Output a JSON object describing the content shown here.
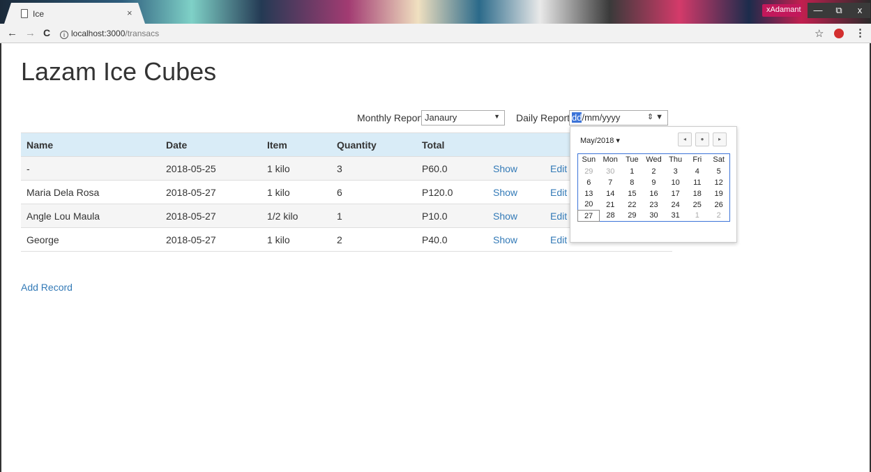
{
  "browser": {
    "tab_title": "Ice",
    "tab_close": "×",
    "user_name": "xAdamant",
    "window_controls": [
      "—",
      "⧉",
      "x"
    ],
    "url_host": "localhost:3000",
    "url_path": "/transacs",
    "info_glyph": "i",
    "back_glyph": "←",
    "forward_glyph": "→",
    "reload_glyph": "C",
    "star_glyph": "☆",
    "menu_glyph": "⋮"
  },
  "page": {
    "title": "Lazam Ice Cubes"
  },
  "filters": {
    "monthly_label": "Monthly Report:",
    "monthly_value": "Janaury",
    "daily_label": "Daily Report:",
    "daily_dd": "dd",
    "daily_rest": "/mm/yyyy",
    "spin_glyph": "⇕ ▼"
  },
  "table": {
    "headers": [
      "Name",
      "Date",
      "Item",
      "Quantity",
      "Total",
      "",
      ""
    ],
    "rows": [
      {
        "name": "-",
        "date": "2018-05-25",
        "item": "1 kilo",
        "quantity": "3",
        "total": "P60.0",
        "show": "Show",
        "edit": "Edit"
      },
      {
        "name": "Maria Dela Rosa",
        "date": "2018-05-27",
        "item": "1 kilo",
        "quantity": "6",
        "total": "P120.0",
        "show": "Show",
        "edit": "Edit"
      },
      {
        "name": "Angle Lou Maula",
        "date": "2018-05-27",
        "item": "1/2 kilo",
        "quantity": "1",
        "total": "P10.0",
        "show": "Show",
        "edit": "Edit"
      },
      {
        "name": "George",
        "date": "2018-05-27",
        "item": "1 kilo",
        "quantity": "2",
        "total": "P40.0",
        "show": "Show",
        "edit": "Edit"
      }
    ]
  },
  "add_record": "Add Record",
  "datepicker": {
    "month_label": "May/2018 ▾",
    "nav": [
      "◂",
      "●",
      "▸"
    ],
    "weekdays": [
      "Sun",
      "Mon",
      "Tue",
      "Wed",
      "Thu",
      "Fri",
      "Sat"
    ],
    "weeks": [
      [
        "29",
        "30",
        "1",
        "2",
        "3",
        "4",
        "5"
      ],
      [
        "6",
        "7",
        "8",
        "9",
        "10",
        "11",
        "12"
      ],
      [
        "13",
        "14",
        "15",
        "16",
        "17",
        "18",
        "19"
      ],
      [
        "20",
        "21",
        "22",
        "23",
        "24",
        "25",
        "26"
      ],
      [
        "27",
        "28",
        "29",
        "30",
        "31",
        "1",
        "2"
      ]
    ],
    "today": "27"
  }
}
